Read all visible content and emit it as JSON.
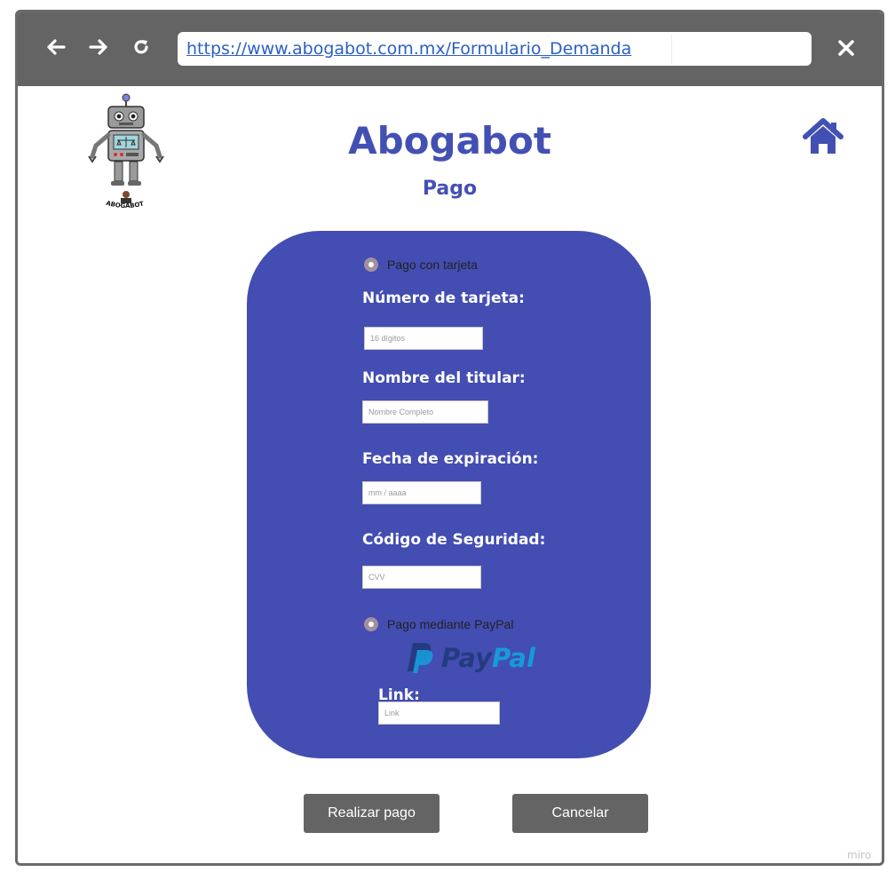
{
  "browser": {
    "back_icon": "arrow-left-icon",
    "forward_icon": "arrow-right-icon",
    "reload_icon": "reload-icon",
    "close_icon": "close-icon",
    "url": "https://www.abogabot.com.mx/Formulario_Demanda"
  },
  "header": {
    "logo_text": "ABOGABOT",
    "title": "Abogabot",
    "subtitle": "Pago",
    "home_icon": "home-icon"
  },
  "form": {
    "card_option": "Pago con tarjeta",
    "card_number_label": "Número de tarjeta:",
    "card_number_placeholder": "16 dígitos",
    "holder_label": "Nombre del titular:",
    "holder_placeholder": "Nombre Completo",
    "expiry_label": "Fecha de expiración:",
    "expiry_placeholder": "mm / aaaa",
    "cvv_label": "Código de Seguridad:",
    "cvv_placeholder": "CVV",
    "paypal_option": "Pago mediante PayPal",
    "paypal_logo_text": "PayPal",
    "link_label": "Link:",
    "link_placeholder": "Link"
  },
  "actions": {
    "pay_label": "Realizar pago",
    "cancel_label": "Cancelar"
  },
  "watermark": "miro",
  "colors": {
    "accent": "#434db2",
    "toolbar": "#646464",
    "link": "#2b5fc7"
  }
}
